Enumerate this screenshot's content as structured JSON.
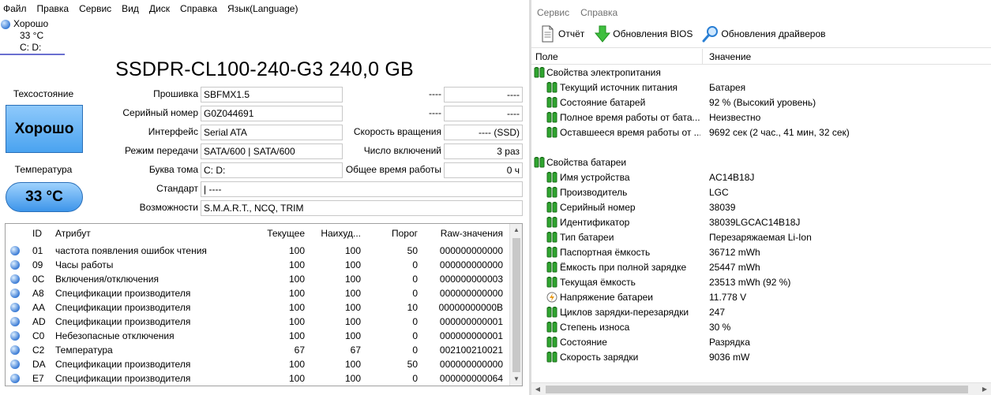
{
  "left": {
    "menu": [
      "Файл",
      "Правка",
      "Сервис",
      "Вид",
      "Диск",
      "Справка",
      "Язык(Language)"
    ],
    "disk_tab": {
      "status": "Хорошо",
      "temp": "33 °C",
      "letters": "C: D:"
    },
    "model": "SSDPR-CL100-240-G3 240,0 GB",
    "health_label": "Техсостояние",
    "health_value": "Хорошо",
    "health_color": "#4aa3f0",
    "temp_label": "Температура",
    "temp_value": "33 °C",
    "fields": {
      "firmware": {
        "label": "Прошивка",
        "value": "SBFMX1.5"
      },
      "serial": {
        "label": "Серийный номер",
        "value": "G0Z044691"
      },
      "interface": {
        "label": "Интерфейс",
        "value": "Serial ATA"
      },
      "transfer": {
        "label": "Режим передачи",
        "value": "SATA/600 | SATA/600"
      },
      "drive_letter": {
        "label": "Буква тома",
        "value": "C: D:"
      },
      "standard": {
        "label": "Стандарт",
        "value": "| ----"
      },
      "features": {
        "label": "Возможности",
        "value": "S.M.A.R.T., NCQ, TRIM"
      },
      "blank1": {
        "label": "----",
        "value": "----"
      },
      "blank2": {
        "label": "----",
        "value": "----"
      },
      "rotation": {
        "label": "Скорость вращения",
        "value": "---- (SSD)"
      },
      "power_count": {
        "label": "Число включений",
        "value": "3 раз"
      },
      "power_hours": {
        "label": "Общее время работы",
        "value": "0 ч"
      }
    },
    "smart": {
      "columns": [
        "ID",
        "Атрибут",
        "Текущее",
        "Наихуд...",
        "Порог",
        "Raw-значения"
      ],
      "rows": [
        {
          "id": "01",
          "attr": "частота появления ошибок чтения",
          "cur": "100",
          "worst": "100",
          "thr": "50",
          "raw": "000000000000"
        },
        {
          "id": "09",
          "attr": "Часы работы",
          "cur": "100",
          "worst": "100",
          "thr": "0",
          "raw": "000000000000"
        },
        {
          "id": "0C",
          "attr": "Включения/отключения",
          "cur": "100",
          "worst": "100",
          "thr": "0",
          "raw": "000000000003"
        },
        {
          "id": "A8",
          "attr": "Спецификации производителя",
          "cur": "100",
          "worst": "100",
          "thr": "0",
          "raw": "000000000000"
        },
        {
          "id": "AA",
          "attr": "Спецификации производителя",
          "cur": "100",
          "worst": "100",
          "thr": "10",
          "raw": "00000000000B"
        },
        {
          "id": "AD",
          "attr": "Спецификации производителя",
          "cur": "100",
          "worst": "100",
          "thr": "0",
          "raw": "000000000001"
        },
        {
          "id": "C0",
          "attr": "Небезопасные отключения",
          "cur": "100",
          "worst": "100",
          "thr": "0",
          "raw": "000000000001"
        },
        {
          "id": "C2",
          "attr": "Температура",
          "cur": "67",
          "worst": "67",
          "thr": "0",
          "raw": "002100210021"
        },
        {
          "id": "DA",
          "attr": "Спецификации производителя",
          "cur": "100",
          "worst": "100",
          "thr": "50",
          "raw": "000000000000"
        },
        {
          "id": "E7",
          "attr": "Спецификации производителя",
          "cur": "100",
          "worst": "100",
          "thr": "0",
          "raw": "000000000064"
        }
      ]
    }
  },
  "right": {
    "menu": [
      "Сервис",
      "Справка"
    ],
    "toolbar": {
      "report": "Отчёт",
      "bios": "Обновления BIOS",
      "drivers": "Обновления драйверов"
    },
    "columns": {
      "field": "Поле",
      "value": "Значение"
    },
    "rows": [
      {
        "type": "group",
        "icon": "battery",
        "name": "Свойства электропитания",
        "value": ""
      },
      {
        "type": "item",
        "icon": "battery",
        "name": "Текущий источник питания",
        "value": "Батарея"
      },
      {
        "type": "item",
        "icon": "battery",
        "name": "Состояние батарей",
        "value": "92 % (Высокий уровень)"
      },
      {
        "type": "item",
        "icon": "battery",
        "name": "Полное время работы от бата...",
        "value": "Неизвестно"
      },
      {
        "type": "item",
        "icon": "battery",
        "name": "Оставшееся время работы от ...",
        "value": "9692 сек (2 час., 41 мин, 32 сек)"
      },
      {
        "type": "spacer",
        "icon": "",
        "name": "",
        "value": ""
      },
      {
        "type": "group",
        "icon": "battery",
        "name": "Свойства батареи",
        "value": ""
      },
      {
        "type": "item",
        "icon": "battery",
        "name": "Имя устройства",
        "value": "AC14B18J"
      },
      {
        "type": "item",
        "icon": "battery",
        "name": "Производитель",
        "value": "LGC"
      },
      {
        "type": "item",
        "icon": "battery",
        "name": "Серийный номер",
        "value": "38039"
      },
      {
        "type": "item",
        "icon": "battery",
        "name": "Идентификатор",
        "value": "38039LGCAC14B18J"
      },
      {
        "type": "item",
        "icon": "battery",
        "name": "Тип батареи",
        "value": "Перезаряжаемая Li-Ion"
      },
      {
        "type": "item",
        "icon": "battery",
        "name": "Паспортная ёмкость",
        "value": "36712 mWh"
      },
      {
        "type": "item",
        "icon": "battery",
        "name": "Ёмкость при полной зарядке",
        "value": "25447 mWh"
      },
      {
        "type": "item",
        "icon": "battery",
        "name": "Текущая ёмкость",
        "value": "23513 mWh  (92 %)"
      },
      {
        "type": "item",
        "icon": "voltage",
        "name": "Напряжение батареи",
        "value": "11.778 V"
      },
      {
        "type": "item",
        "icon": "battery",
        "name": "Циклов зарядки-перезарядки",
        "value": "247"
      },
      {
        "type": "item",
        "icon": "battery",
        "name": "Степень износа",
        "value": "30 %"
      },
      {
        "type": "item",
        "icon": "battery",
        "name": "Состояние",
        "value": "Разрядка"
      },
      {
        "type": "item",
        "icon": "battery",
        "name": "Скорость зарядки",
        "value": "9036 mW"
      }
    ]
  }
}
